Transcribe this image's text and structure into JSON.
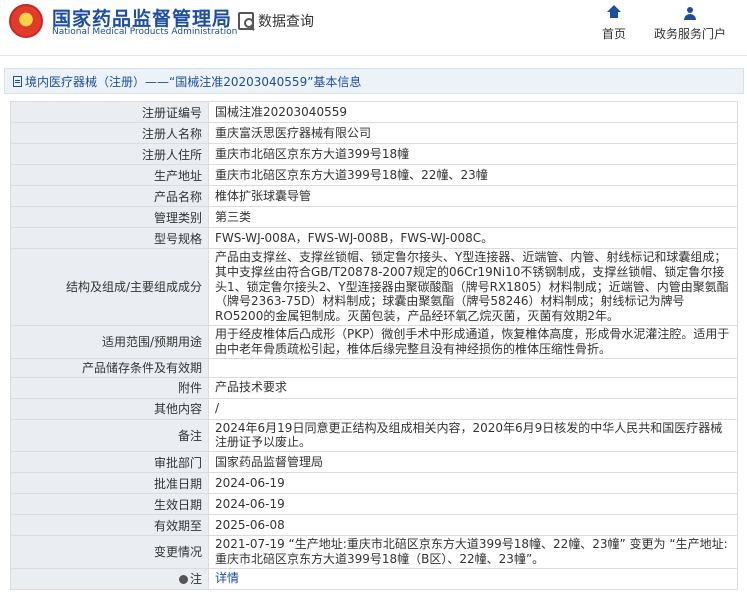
{
  "header": {
    "logo_cn": "国家药品监督管理局",
    "logo_en": "National Medical Products Administration",
    "data_query": "数据查询",
    "nav": [
      {
        "label": "首页",
        "icon": "home-icon"
      },
      {
        "label": "政务服务门户",
        "icon": "user-icon"
      }
    ]
  },
  "breadcrumb": {
    "text": "境内医疗器械（注册）——“国械注准20203040559”基本信息"
  },
  "fields": [
    {
      "label": "注册证编号",
      "value": "国械注准20203040559"
    },
    {
      "label": "注册人名称",
      "value": "重庆富沃思医疗器械有限公司"
    },
    {
      "label": "注册人住所",
      "value": "重庆市北碚区京东方大道399号18幢"
    },
    {
      "label": "生产地址",
      "value": "重庆市北碚区京东方大道399号18幢、22幢、23幢"
    },
    {
      "label": "产品名称",
      "value": "椎体扩张球囊导管"
    },
    {
      "label": "管理类别",
      "value": "第三类"
    },
    {
      "label": "型号规格",
      "value": "FWS-WJ-008A，FWS-WJ-008B，FWS-WJ-008C。"
    },
    {
      "label": "结构及组成/主要组成成分",
      "value": "产品由支撑丝、支撑丝锁帽、锁定鲁尔接头、Y型连接器、近端管、内管、射线标记和球囊组成；其中支撑丝由符合GB/T20878-2007规定的06Cr19Ni10不锈钢制成，支撑丝锁帽、锁定鲁尔接头1、锁定鲁尔接头2、Y型连接器由聚碳酸酯（牌号RX1805）材料制成；近端管、内管由聚氨酯（牌号2363-75D）材料制成；球囊由聚氨酯（牌号58246）材料制成；射线标记为牌号RO5200的金属钽制成。灭菌包装，产品经环氧乙烷灭菌，灭菌有效期2年。"
    },
    {
      "label": "适用范围/预期用途",
      "value": "用于经皮椎体后凸成形（PKP）微创手术中形成通道，恢复椎体高度，形成骨水泥灌注腔。适用于由中老年骨质疏松引起，椎体后缘完整且没有神经损伤的椎体压缩性骨折。"
    },
    {
      "label": "产品储存条件及有效期",
      "value": ""
    },
    {
      "label": "附件",
      "value": "产品技术要求"
    },
    {
      "label": "其他内容",
      "value": "/"
    },
    {
      "label": "备注",
      "value": "2024年6月19日同意更正结构及组成相关内容，2020年6月9日核发的中华人民共和国医疗器械注册证予以废止。"
    },
    {
      "label": "审批部门",
      "value": "国家药品监督管理局"
    },
    {
      "label": "批准日期",
      "value": "2024-06-19"
    },
    {
      "label": "生效日期",
      "value": "2024-06-19"
    },
    {
      "label": "有效期至",
      "value": "2025-06-08"
    },
    {
      "label": "变更情况",
      "value": "2021-07-19 “生产地址:重庆市北碚区京东方大道399号18幢、22幢、23幢” 变更为 “生产地址:重庆市北碚区京东方大道399号18幢（B区）、22幢、23幢”。"
    },
    {
      "label": "注",
      "value": "详情"
    }
  ]
}
